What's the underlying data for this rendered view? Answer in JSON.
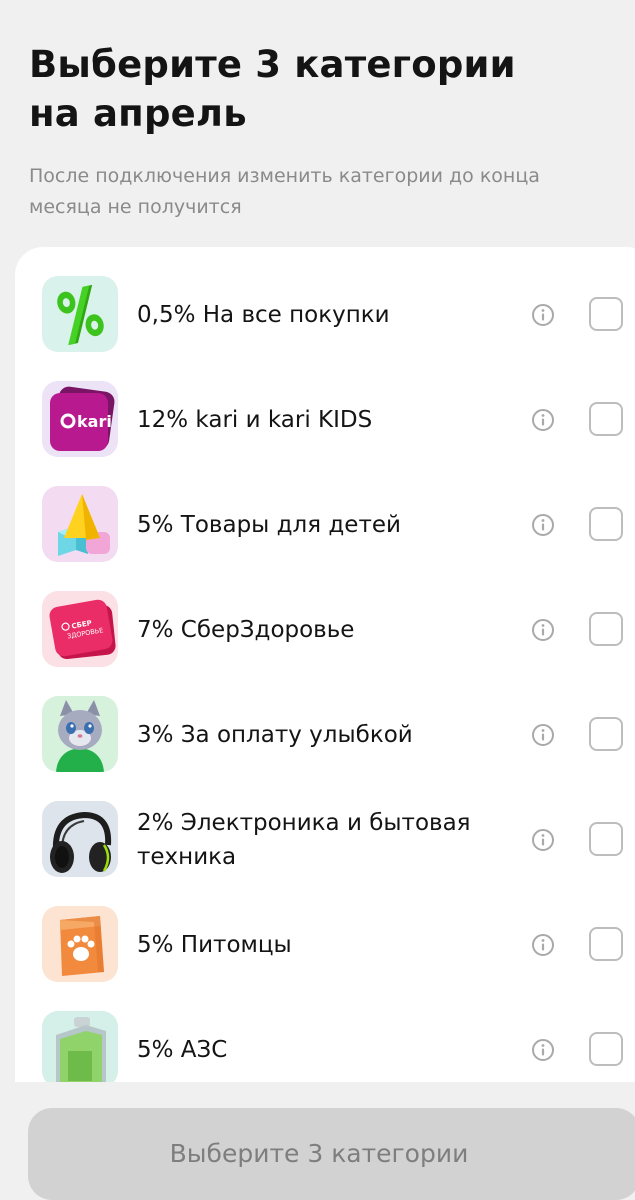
{
  "header": {
    "title_line1": "Выберите 3 категории",
    "title_line2": "на апрель",
    "subtitle_line1": "После подключения изменить категории до конца",
    "subtitle_line2": "месяца не получится"
  },
  "categories": [
    {
      "label": "0,5% На все покупки",
      "icon": "percent-icon",
      "selected": false
    },
    {
      "label": "12% kari и kari KIDS",
      "icon": "kari-logo-icon",
      "brand_text": "kari",
      "selected": false
    },
    {
      "label": "5% Товары для детей",
      "icon": "toy-blocks-icon",
      "selected": false
    },
    {
      "label": "7% СберЗдоровье",
      "icon": "sber-health-logo-icon",
      "brand_text_line1": "СБЕР",
      "brand_text_line2": "ЗДОРОВЬЕ",
      "selected": false
    },
    {
      "label": "3% За оплату улыбкой",
      "icon": "cat-mascot-icon",
      "selected": false
    },
    {
      "label_line1": "2% Электроника и бытовая",
      "label_line2": "техника",
      "icon": "headphones-icon",
      "selected": false
    },
    {
      "label": "5% Питомцы",
      "icon": "pet-food-bag-icon",
      "selected": false
    },
    {
      "label": "5% АЗС",
      "icon": "fuel-canister-icon",
      "selected": false
    }
  ],
  "footer": {
    "button_label": "Выберите 3 категории"
  },
  "colors": {
    "background": "#f0f0f0",
    "card": "#ffffff",
    "button_disabled_bg": "#d2d2d2",
    "button_disabled_text": "#7e7e7e",
    "checkbox_border": "#bdbdbd",
    "subtitle": "#8a8a8a"
  }
}
